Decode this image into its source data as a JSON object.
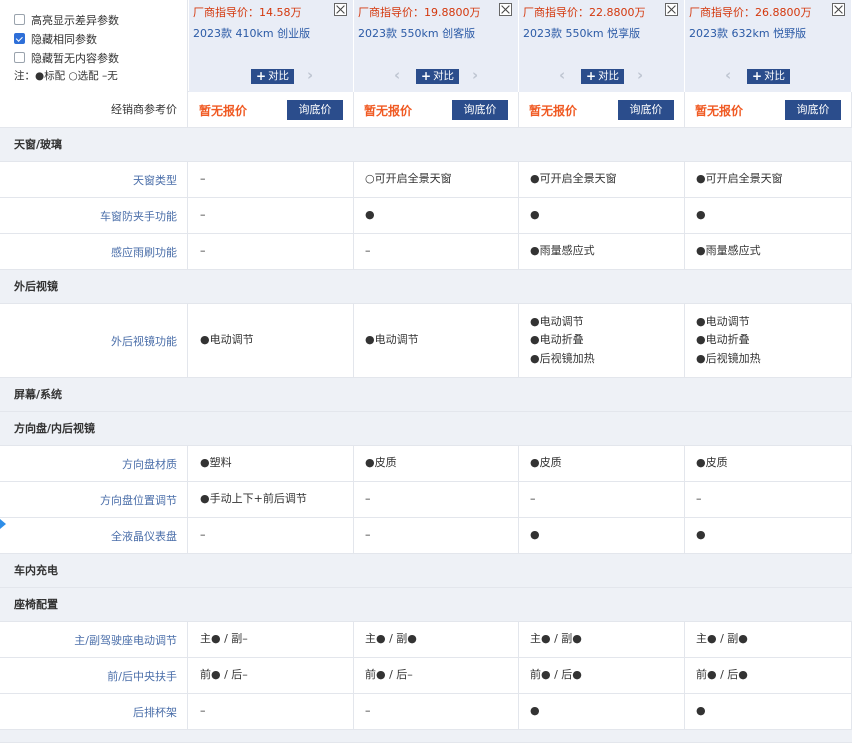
{
  "options": [
    {
      "label": "高亮显示差异参数",
      "checked": false
    },
    {
      "label": "隐藏相同参数",
      "checked": true
    },
    {
      "label": "隐藏暂无内容参数",
      "checked": false
    }
  ],
  "legend": "注：●标配 ○选配 –无",
  "cars": [
    {
      "price": "厂商指导价：14.58万",
      "model": "2023款 410km 创业版",
      "compare_label": "对比"
    },
    {
      "price": "厂商指导价：19.8800万",
      "model": "2023款 550km 创客版",
      "compare_label": "对比"
    },
    {
      "price": "厂商指导价：22.8800万",
      "model": "2023款 550km 悦享版",
      "compare_label": "对比"
    },
    {
      "price": "厂商指导价：26.8800万",
      "model": "2023款 632km 悦野版",
      "compare_label": "对比"
    }
  ],
  "icons": {
    "close": "close-icon",
    "prev": "chevron-left-icon",
    "next": "chevron-right-icon",
    "plus": "plus-icon",
    "pointer": "arrow-right-icon"
  },
  "glyphs": {
    "prev": "‹",
    "next": "›",
    "plus": "+"
  },
  "dealer": {
    "label": "经销商参考价",
    "no_price": "暂无报价",
    "ask_label": "询底价"
  },
  "colors": {
    "accent": "#2b4d8c",
    "price": "#d4380d",
    "no_price": "#f05a23",
    "model": "#2b5aa6",
    "pointer": "#2e8ee8"
  },
  "sections": [
    {
      "title": "天窗/玻璃",
      "rows": [
        {
          "label": "天窗类型",
          "values": [
            [
              "–"
            ],
            [
              "○可开启全景天窗"
            ],
            [
              "●可开启全景天窗"
            ],
            [
              "●可开启全景天窗"
            ]
          ]
        },
        {
          "label": "车窗防夹手功能",
          "values": [
            [
              "–"
            ],
            [
              "●"
            ],
            [
              "●"
            ],
            [
              "●"
            ]
          ]
        },
        {
          "label": "感应雨刷功能",
          "values": [
            [
              "–"
            ],
            [
              "–"
            ],
            [
              "●雨量感应式"
            ],
            [
              "●雨量感应式"
            ]
          ]
        }
      ]
    },
    {
      "title": "外后视镜",
      "rows": [
        {
          "label": "外后视镜功能",
          "values": [
            [
              "●电动调节"
            ],
            [
              "●电动调节"
            ],
            [
              "●电动调节",
              "●电动折叠",
              "●后视镜加热"
            ],
            [
              "●电动调节",
              "●电动折叠",
              "●后视镜加热"
            ]
          ]
        }
      ]
    },
    {
      "title": "屏幕/系统",
      "rows": []
    },
    {
      "title": "方向盘/内后视镜",
      "rows": [
        {
          "label": "方向盘材质",
          "values": [
            [
              "●塑料"
            ],
            [
              "●皮质"
            ],
            [
              "●皮质"
            ],
            [
              "●皮质"
            ]
          ]
        },
        {
          "label": "方向盘位置调节",
          "values": [
            [
              "●手动上下+前后调节"
            ],
            [
              "–"
            ],
            [
              "–"
            ],
            [
              "–"
            ]
          ]
        },
        {
          "label": "全液晶仪表盘",
          "values": [
            [
              "–"
            ],
            [
              "–"
            ],
            [
              "●"
            ],
            [
              "●"
            ]
          ]
        }
      ]
    },
    {
      "title": "车内充电",
      "rows": []
    },
    {
      "title": "座椅配置",
      "rows": [
        {
          "label": "主/副驾驶座电动调节",
          "values": [
            [
              "主● / 副–"
            ],
            [
              "主● / 副●"
            ],
            [
              "主● / 副●"
            ],
            [
              "主● / 副●"
            ]
          ]
        },
        {
          "label": "前/后中央扶手",
          "values": [
            [
              "前● / 后–"
            ],
            [
              "前● / 后–"
            ],
            [
              "前● / 后●"
            ],
            [
              "前● / 后●"
            ]
          ]
        },
        {
          "label": "后排杯架",
          "values": [
            [
              "–"
            ],
            [
              "–"
            ],
            [
              "●"
            ],
            [
              "●"
            ]
          ]
        }
      ]
    }
  ]
}
